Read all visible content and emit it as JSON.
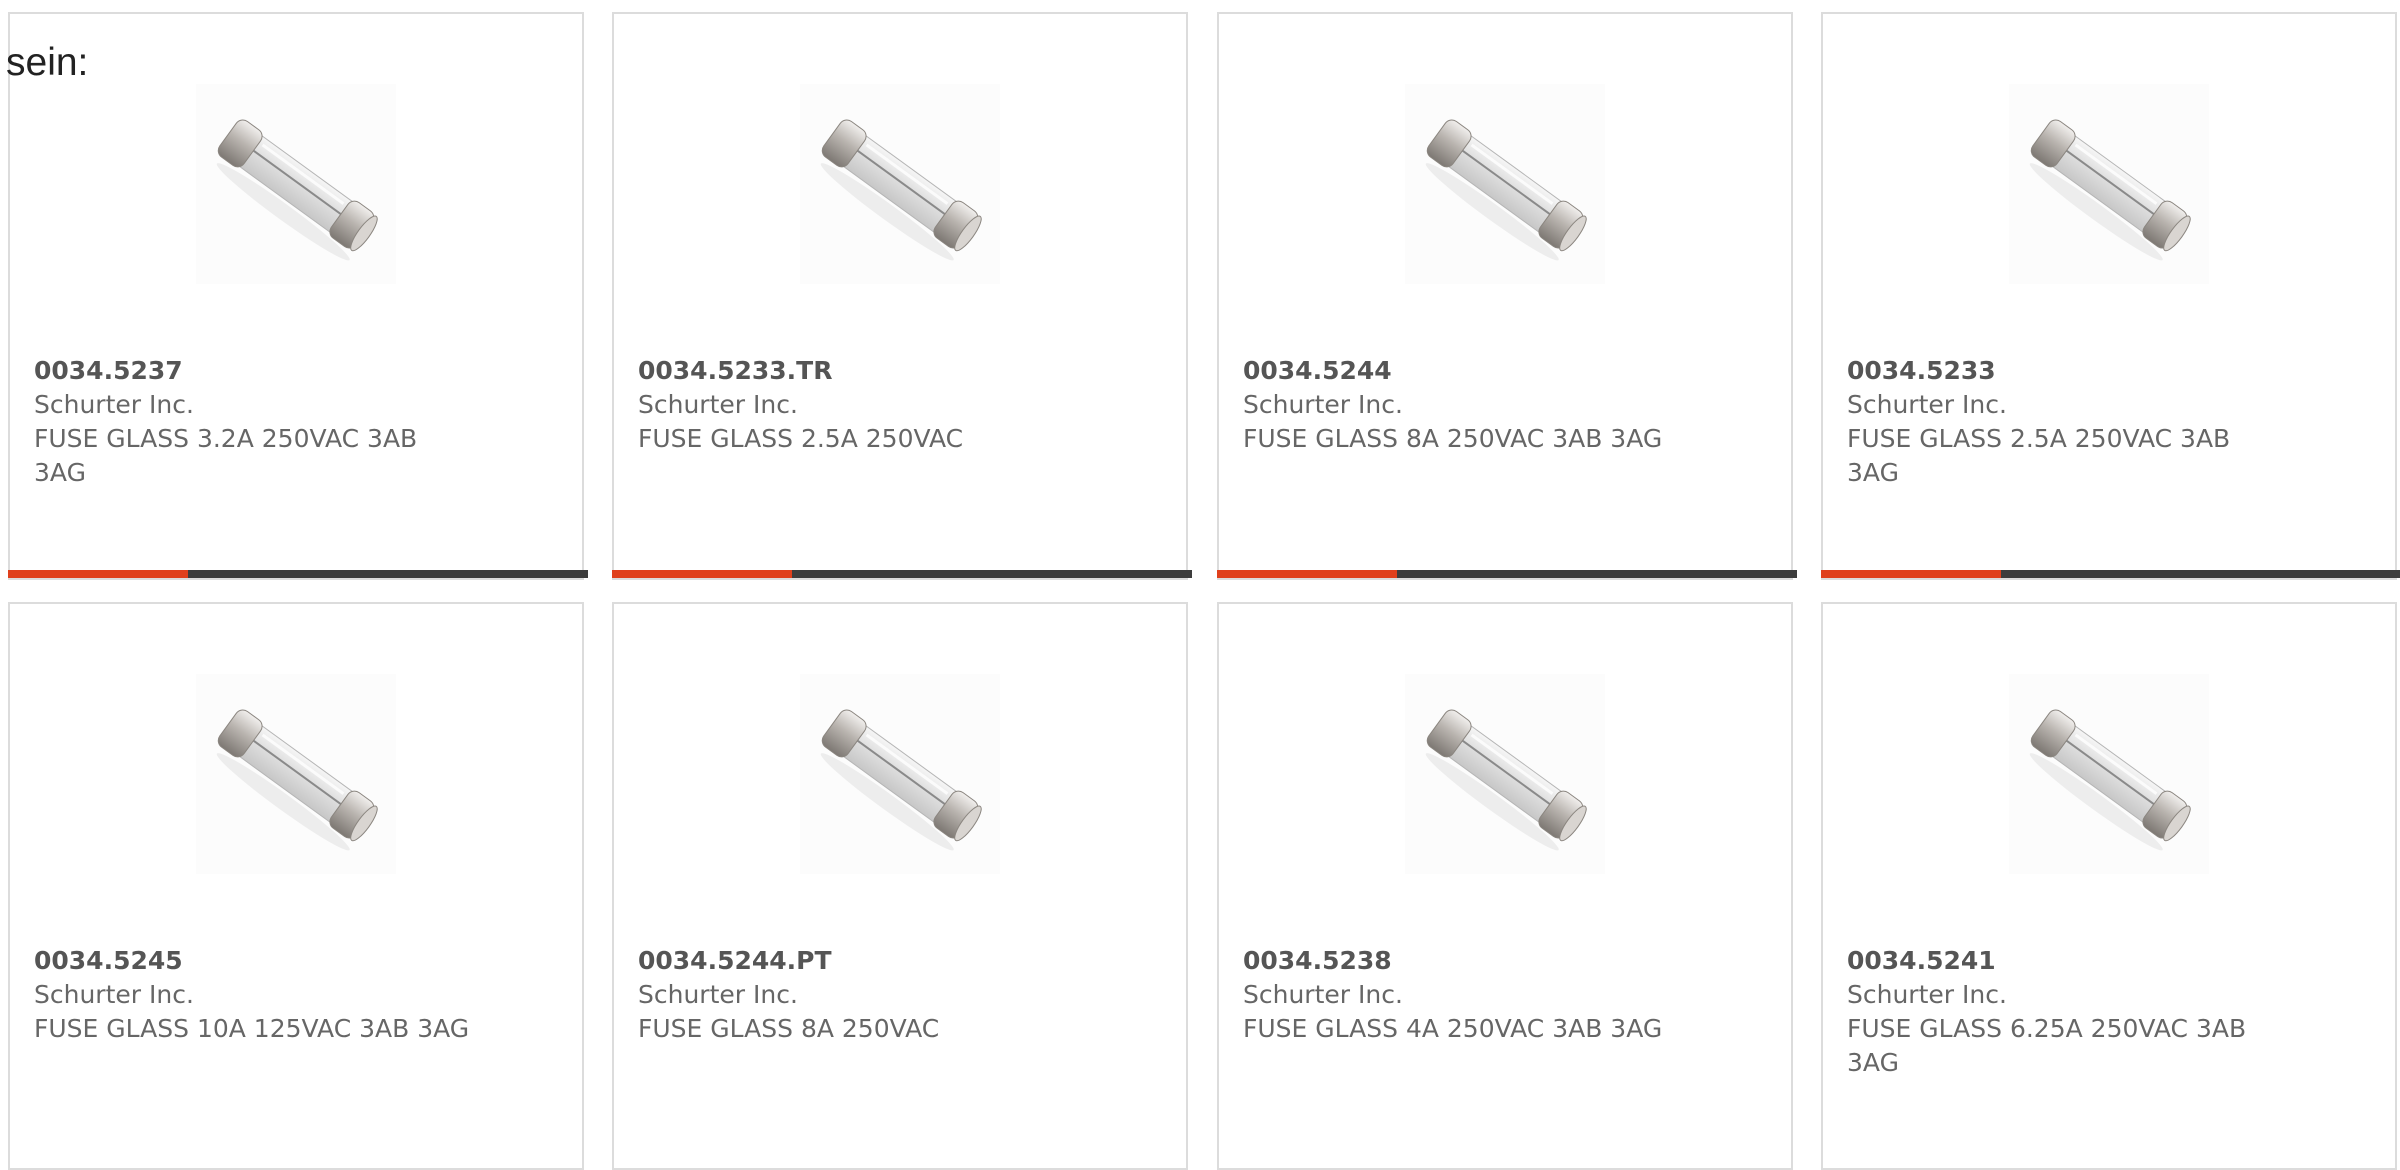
{
  "intro_text": "sein:",
  "colors": {
    "accent": "#e0401c",
    "bar_dark": "#3d3d3d",
    "card_border": "#dcdcdc",
    "text": "#555555"
  },
  "products": [
    {
      "part_no": "0034.5237",
      "manufacturer": "Schurter Inc.",
      "description": "FUSE GLASS 3.2A 250VAC 3AB 3AG",
      "image_icon": "glass-fuse-icon",
      "progress_fraction": 0.31
    },
    {
      "part_no": "0034.5233.TR",
      "manufacturer": "Schurter Inc.",
      "description": "FUSE GLASS 2.5A 250VAC",
      "image_icon": "glass-fuse-icon",
      "progress_fraction": 0.31
    },
    {
      "part_no": "0034.5244",
      "manufacturer": "Schurter Inc.",
      "description": "FUSE GLASS 8A 250VAC 3AB 3AG",
      "image_icon": "glass-fuse-icon",
      "progress_fraction": 0.31
    },
    {
      "part_no": "0034.5233",
      "manufacturer": "Schurter Inc.",
      "description": "FUSE GLASS 2.5A 250VAC 3AB 3AG",
      "image_icon": "glass-fuse-icon",
      "progress_fraction": 0.31
    },
    {
      "part_no": "0034.5245",
      "manufacturer": "Schurter Inc.",
      "description": "FUSE GLASS 10A 125VAC 3AB 3AG",
      "image_icon": "glass-fuse-icon"
    },
    {
      "part_no": "0034.5244.PT",
      "manufacturer": "Schurter Inc.",
      "description": "FUSE GLASS 8A 250VAC",
      "image_icon": "glass-fuse-icon"
    },
    {
      "part_no": "0034.5238",
      "manufacturer": "Schurter Inc.",
      "description": "FUSE GLASS 4A 250VAC 3AB 3AG",
      "image_icon": "glass-fuse-icon"
    },
    {
      "part_no": "0034.5241",
      "manufacturer": "Schurter Inc.",
      "description": "FUSE GLASS 6.25A 250VAC 3AB 3AG",
      "image_icon": "glass-fuse-icon"
    }
  ]
}
